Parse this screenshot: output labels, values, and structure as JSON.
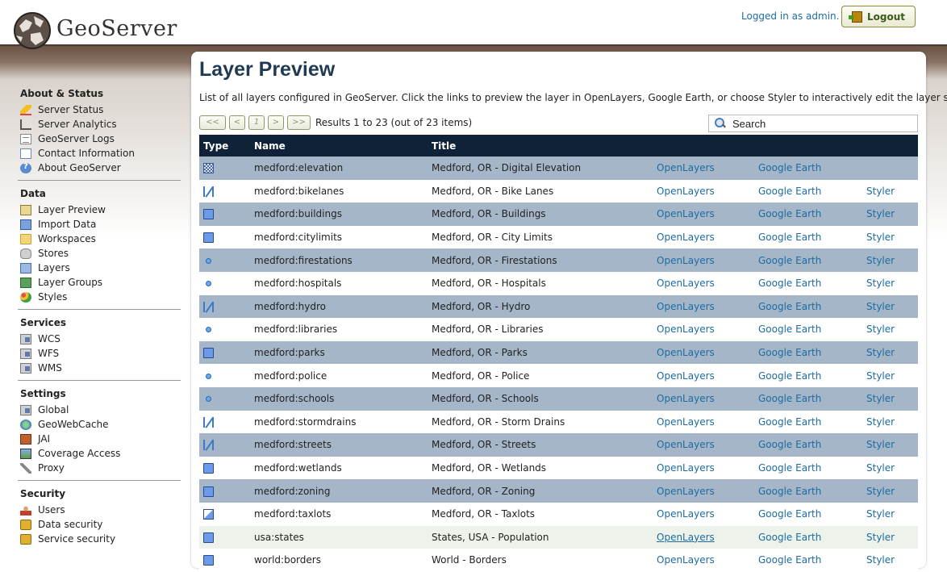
{
  "header": {
    "app_name": "GeoServer",
    "logged_in": "Logged in as admin.",
    "logout_label": "Logout"
  },
  "sidebar": {
    "sections": [
      {
        "title": "About & Status",
        "items": [
          {
            "label": "Server Status",
            "icon": "server-status-icon"
          },
          {
            "label": "Server Analytics",
            "icon": "analytics-icon"
          },
          {
            "label": "GeoServer Logs",
            "icon": "logs-icon"
          },
          {
            "label": "Contact Information",
            "icon": "contact-icon"
          },
          {
            "label": "About GeoServer",
            "icon": "about-icon"
          }
        ]
      },
      {
        "title": "Data",
        "items": [
          {
            "label": "Layer Preview",
            "icon": "layer-preview-icon"
          },
          {
            "label": "Import Data",
            "icon": "import-icon"
          },
          {
            "label": "Workspaces",
            "icon": "folder-icon"
          },
          {
            "label": "Stores",
            "icon": "database-icon"
          },
          {
            "label": "Layers",
            "icon": "layer-icon"
          },
          {
            "label": "Layer Groups",
            "icon": "layer-group-icon"
          },
          {
            "label": "Styles",
            "icon": "styles-icon"
          }
        ]
      },
      {
        "title": "Services",
        "items": [
          {
            "label": "WCS",
            "icon": "server-icon"
          },
          {
            "label": "WFS",
            "icon": "server-icon"
          },
          {
            "label": "WMS",
            "icon": "server-icon"
          }
        ]
      },
      {
        "title": "Settings",
        "items": [
          {
            "label": "Global",
            "icon": "server-icon"
          },
          {
            "label": "GeoWebCache",
            "icon": "globe-icon"
          },
          {
            "label": "JAI",
            "icon": "jai-icon"
          },
          {
            "label": "Coverage Access",
            "icon": "coverage-icon"
          },
          {
            "label": "Proxy",
            "icon": "wrench-icon"
          }
        ]
      },
      {
        "title": "Security",
        "items": [
          {
            "label": "Users",
            "icon": "users-icon"
          },
          {
            "label": "Data security",
            "icon": "lock-icon"
          },
          {
            "label": "Service security",
            "icon": "lock-icon"
          }
        ]
      }
    ]
  },
  "main": {
    "title": "Layer Preview",
    "description": "List of all layers configured in GeoServer. Click the links to preview the layer in OpenLayers, Google Earth, or choose Styler to interactively edit the layer style.",
    "pager": {
      "first": "<<",
      "prev": "<",
      "current": "1",
      "next": ">",
      "last": ">>",
      "info": "Results 1 to 23 (out of 23 items)"
    },
    "search_placeholder": "Search",
    "columns": {
      "type": "Type",
      "name": "Name",
      "title": "Title"
    },
    "rows": [
      {
        "type": "raster",
        "name": "medford:elevation",
        "title": "Medford, OR - Digital Elevation",
        "openlayers": "OpenLayers",
        "google_earth": "Google Earth",
        "styler": ""
      },
      {
        "type": "line",
        "name": "medford:bikelanes",
        "title": "Medford, OR - Bike Lanes",
        "openlayers": "OpenLayers",
        "google_earth": "Google Earth",
        "styler": "Styler"
      },
      {
        "type": "polygon",
        "name": "medford:buildings",
        "title": "Medford, OR - Buildings",
        "openlayers": "OpenLayers",
        "google_earth": "Google Earth",
        "styler": "Styler"
      },
      {
        "type": "polygon",
        "name": "medford:citylimits",
        "title": "Medford, OR - City Limits",
        "openlayers": "OpenLayers",
        "google_earth": "Google Earth",
        "styler": "Styler"
      },
      {
        "type": "point",
        "name": "medford:firestations",
        "title": "Medford, OR - Firestations",
        "openlayers": "OpenLayers",
        "google_earth": "Google Earth",
        "styler": "Styler"
      },
      {
        "type": "point",
        "name": "medford:hospitals",
        "title": "Medford, OR - Hospitals",
        "openlayers": "OpenLayers",
        "google_earth": "Google Earth",
        "styler": "Styler"
      },
      {
        "type": "line",
        "name": "medford:hydro",
        "title": "Medford, OR - Hydro",
        "openlayers": "OpenLayers",
        "google_earth": "Google Earth",
        "styler": "Styler"
      },
      {
        "type": "point",
        "name": "medford:libraries",
        "title": "Medford, OR - Libraries",
        "openlayers": "OpenLayers",
        "google_earth": "Google Earth",
        "styler": "Styler"
      },
      {
        "type": "polygon",
        "name": "medford:parks",
        "title": "Medford, OR - Parks",
        "openlayers": "OpenLayers",
        "google_earth": "Google Earth",
        "styler": "Styler"
      },
      {
        "type": "point",
        "name": "medford:police",
        "title": "Medford, OR - Police",
        "openlayers": "OpenLayers",
        "google_earth": "Google Earth",
        "styler": "Styler"
      },
      {
        "type": "point",
        "name": "medford:schools",
        "title": "Medford, OR - Schools",
        "openlayers": "OpenLayers",
        "google_earth": "Google Earth",
        "styler": "Styler"
      },
      {
        "type": "line",
        "name": "medford:stormdrains",
        "title": "Medford, OR - Storm Drains",
        "openlayers": "OpenLayers",
        "google_earth": "Google Earth",
        "styler": "Styler"
      },
      {
        "type": "line",
        "name": "medford:streets",
        "title": "Medford, OR - Streets",
        "openlayers": "OpenLayers",
        "google_earth": "Google Earth",
        "styler": "Styler"
      },
      {
        "type": "polygon",
        "name": "medford:wetlands",
        "title": "Medford, OR - Wetlands",
        "openlayers": "OpenLayers",
        "google_earth": "Google Earth",
        "styler": "Styler"
      },
      {
        "type": "polygon",
        "name": "medford:zoning",
        "title": "Medford, OR - Zoning",
        "openlayers": "OpenLayers",
        "google_earth": "Google Earth",
        "styler": "Styler"
      },
      {
        "type": "mixed",
        "name": "medford:taxlots",
        "title": "Medford, OR - Taxlots",
        "openlayers": "OpenLayers",
        "google_earth": "Google Earth",
        "styler": "Styler"
      },
      {
        "type": "polygon",
        "name": "usa:states",
        "title": "States, USA - Population",
        "openlayers": "OpenLayers",
        "google_earth": "Google Earth",
        "styler": "Styler",
        "hover": true
      },
      {
        "type": "polygon",
        "name": "world:borders",
        "title": "World - Borders",
        "openlayers": "OpenLayers",
        "google_earth": "Google Earth",
        "styler": "Styler"
      }
    ]
  },
  "colors": {
    "header_dark": "#0f2238",
    "row_alt": "#a5b6c8",
    "link": "#1d6ca1"
  }
}
